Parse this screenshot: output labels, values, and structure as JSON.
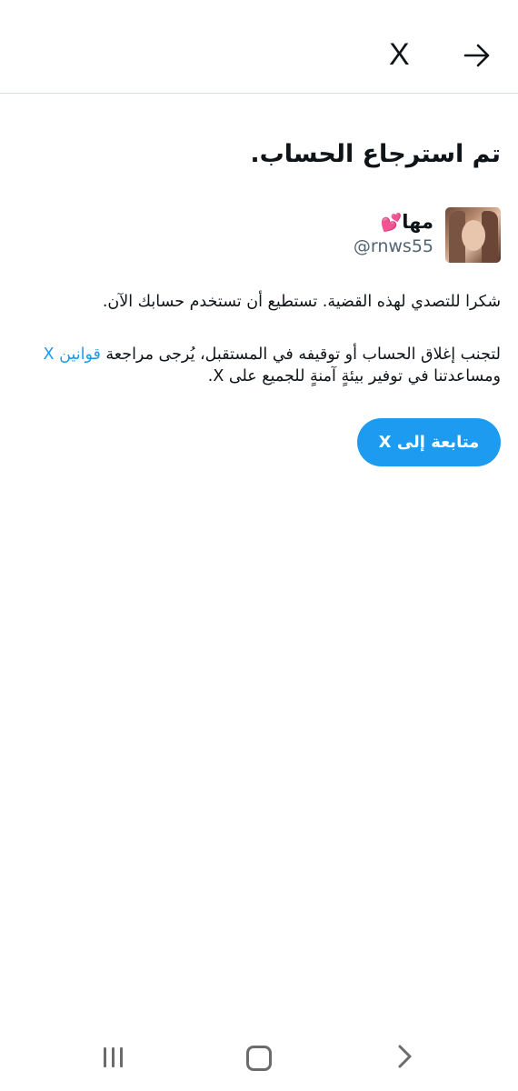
{
  "header": {
    "logo_text": "X",
    "next_icon": "arrow-right-icon"
  },
  "main": {
    "title": "تم استرجاع الحساب.",
    "account": {
      "display_name": "مها",
      "name_emoji": "💕",
      "handle": "@rnws55",
      "avatar_icon": "profile-photo"
    },
    "paragraph1": "شكرا للتصدي لهذه القضية. تستطيع أن تستخدم حسابك الآن.",
    "paragraph2_before": "لتجنب إغلاق الحساب أو توقيفه في المستقبل، يُرجى مراجعة ",
    "paragraph2_link": "قوانين X",
    "paragraph2_after": " ومساعدتنا في توفير بيئةٍ آمنةٍ للجميع على X.",
    "continue_label": "متابعة إلى X"
  },
  "navbar": {
    "recents_icon": "recent-apps-icon",
    "home_icon": "home-icon",
    "back_icon": "back-icon"
  },
  "colors": {
    "accent": "#1d9bf0",
    "text": "#0f1419",
    "secondary_text": "#536471",
    "divider": "#cfe3e6",
    "nav_icons": "#6b6b6b"
  }
}
